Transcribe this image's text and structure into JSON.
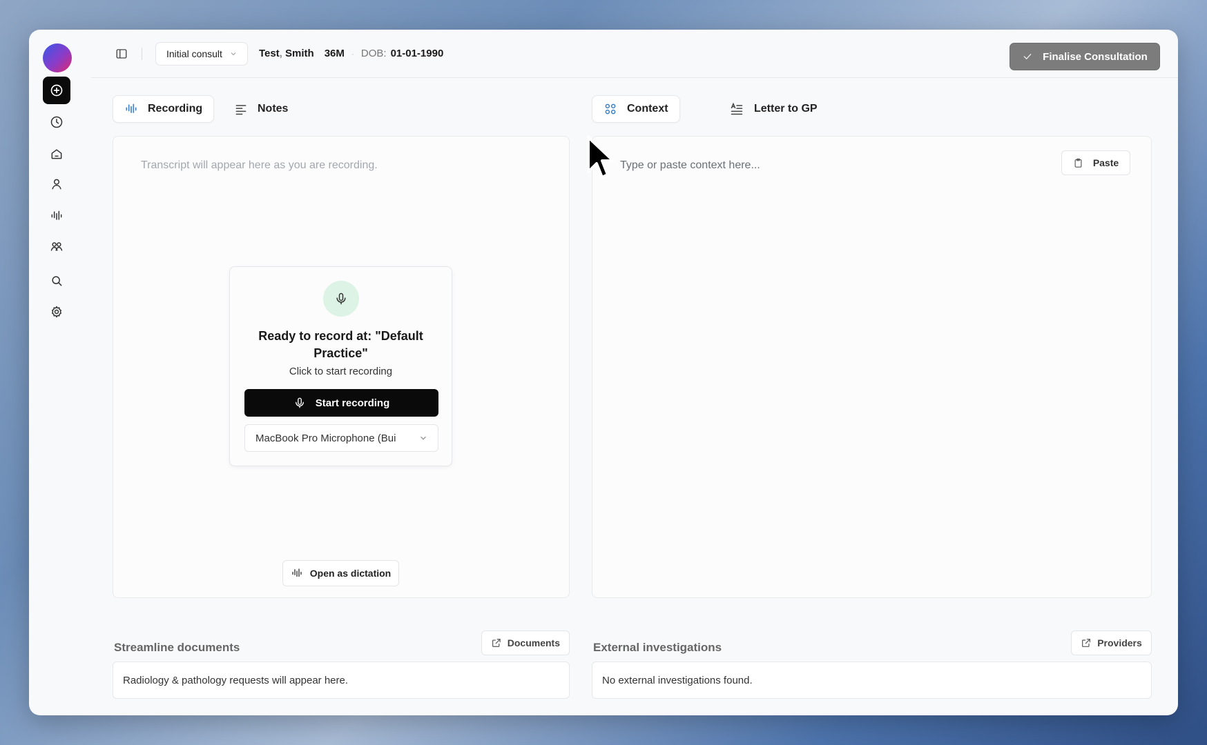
{
  "header": {
    "consult_type": "Initial consult",
    "patient_first": "Test",
    "patient_last": "Smith",
    "patient_age_sex": "36M",
    "dob_label": "DOB:",
    "dob_value": "01-01-1990",
    "finalise_label": "Finalise Consultation"
  },
  "sidebar": {
    "items": [
      {
        "name": "new-consult",
        "icon": "plus-circle-icon",
        "active": true
      },
      {
        "name": "history",
        "icon": "clock-icon"
      },
      {
        "name": "home",
        "icon": "home-icon"
      },
      {
        "name": "patient",
        "icon": "user-icon"
      },
      {
        "name": "recordings",
        "icon": "waveform-icon"
      },
      {
        "name": "team",
        "icon": "users-icon"
      },
      {
        "name": "search",
        "icon": "search-icon"
      },
      {
        "name": "settings",
        "icon": "gear-icon"
      }
    ]
  },
  "left_tabs": [
    {
      "label": "Recording",
      "selected": true
    },
    {
      "label": "Notes",
      "selected": false
    }
  ],
  "right_tabs": [
    {
      "label": "Context",
      "selected": true
    },
    {
      "label": "Letter to GP",
      "selected": false
    }
  ],
  "recording": {
    "transcript_placeholder": "Transcript will appear here as you are recording.",
    "ready_title": "Ready to record at: \"Default Practice\"",
    "ready_subtitle": "Click to start recording",
    "start_label": "Start recording",
    "microphone": "MacBook Pro Microphone (Bui",
    "dictation_label": "Open as dictation"
  },
  "context": {
    "placeholder": "Type or paste context here...",
    "paste_label": "Paste"
  },
  "documents": {
    "title": "Streamline documents",
    "button_label": "Documents",
    "empty_text": "Radiology & pathology requests will appear here."
  },
  "investigations": {
    "title": "External investigations",
    "button_label": "Providers",
    "empty_text": "No external investigations found."
  },
  "colors": {
    "accent_blue": "#3b82c4",
    "finalise_bg": "#7c7c7c",
    "mic_bg": "#dcf3e5"
  }
}
